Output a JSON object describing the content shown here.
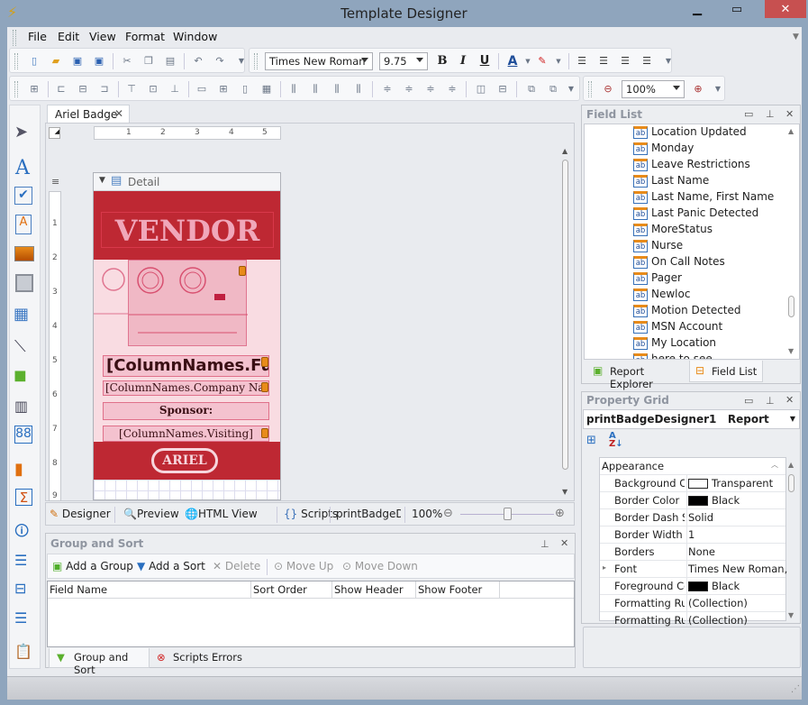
{
  "window": {
    "title": "Template Designer",
    "icon": "app-icon",
    "controls": [
      "minimize",
      "maximize",
      "close"
    ]
  },
  "menu": [
    "File",
    "Edit",
    "View",
    "Format",
    "Window"
  ],
  "toolbar": {
    "font_name": "Times New Roman",
    "font_size": "9.75",
    "bold": "B",
    "italic": "I",
    "underline": "U",
    "zoom": "100%",
    "icons": [
      "new-icon",
      "open-icon",
      "save-icon",
      "save-all-icon",
      "cut-icon",
      "copy-icon",
      "paste-icon",
      "undo-icon",
      "redo-icon",
      "font-color-icon",
      "highlight-icon",
      "align-left-icon",
      "align-center-icon",
      "align-right-icon",
      "justify-icon",
      "zoom-out-icon",
      "zoom-in-icon"
    ]
  },
  "toolbox": [
    "pointer-icon",
    "label-icon",
    "checkbox-icon",
    "richtext-icon",
    "picture-icon",
    "panel-icon",
    "table-icon",
    "line-icon",
    "shape-icon",
    "barcode-icon",
    "zipcode-icon",
    "chart-icon",
    "summary-icon",
    "pageinfo-icon",
    "pagebreak-icon",
    "crossband-line-icon",
    "crossband-box-icon",
    "subreport-icon"
  ],
  "document": {
    "tab_label": "Ariel Badge",
    "ruler_h": [
      "1",
      "2",
      "3",
      "4",
      "5"
    ],
    "ruler_v": [
      "1",
      "2",
      "3",
      "4",
      "5",
      "6",
      "7",
      "8",
      "9"
    ],
    "band_label": "Detail",
    "badge": {
      "title": "VENDOR",
      "field_full_name": "[ColumnNames.Fu",
      "field_company": "[ColumnNames.Company Nam",
      "sponsor_label": "Sponsor:",
      "field_visiting": "[ColumnNames.Visiting]",
      "logo": "ARIEL",
      "colors": {
        "band": "#be2833",
        "body": "#f9dce2",
        "title": "#f0a7ba"
      }
    }
  },
  "viewbar": {
    "tabs": [
      "Designer",
      "Preview",
      "HTML View",
      "Scripts"
    ],
    "report_name": "printBadgeDe",
    "zoom": "100%",
    "zoom_slider_fraction": 0.5
  },
  "group_sort": {
    "title": "Group and Sort",
    "buttons": [
      "Add a Group",
      "Add a Sort",
      "Delete",
      "Move Up",
      "Move Down"
    ],
    "columns": [
      "Field Name",
      "Sort Order",
      "Show Header",
      "Show Footer"
    ],
    "rows": [],
    "bottom_tabs": [
      "Group and Sort",
      "Scripts Errors"
    ]
  },
  "field_list": {
    "title": "Field List",
    "items": [
      "Location Updated",
      "Monday",
      "Leave Restrictions",
      "Last Name",
      "Last Name, First Name",
      "Last Panic Detected",
      "MoreStatus",
      "Nurse",
      "On Call Notes",
      "Pager",
      "Newloc",
      "Motion Detected",
      "MSN Account",
      "My Location",
      "here to see"
    ],
    "bottom_tabs": [
      "Report Explorer",
      "Field List"
    ]
  },
  "property_grid": {
    "title": "Property Grid",
    "selected_object": "printBadgeDesigner1",
    "selected_type": "Report",
    "category": "Appearance",
    "properties": [
      {
        "name": "Background Col",
        "value": "Transparent",
        "swatch": "#ffffff"
      },
      {
        "name": "Border Color",
        "value": "Black",
        "swatch": "#000000"
      },
      {
        "name": "Border Dash Sty",
        "value": "Solid"
      },
      {
        "name": "Border Width",
        "value": "1"
      },
      {
        "name": "Borders",
        "value": "None"
      },
      {
        "name": "Font",
        "value": "Times New Roman,...",
        "expandable": true
      },
      {
        "name": "Foreground Col",
        "value": "Black",
        "swatch": "#000000"
      },
      {
        "name": "Formatting Rule",
        "value": "(Collection)"
      },
      {
        "name": "Formatting Rule",
        "value": "(Collection)"
      }
    ]
  }
}
